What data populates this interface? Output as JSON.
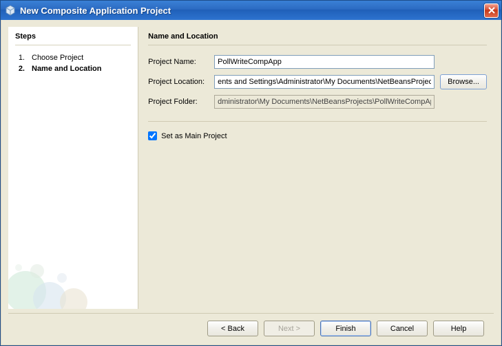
{
  "window": {
    "title": "New Composite Application Project"
  },
  "sidebar": {
    "heading": "Steps",
    "steps": [
      {
        "num": "1.",
        "label": "Choose Project"
      },
      {
        "num": "2.",
        "label": "Name and Location"
      }
    ]
  },
  "content": {
    "heading": "Name and Location",
    "project_name_label": "Project Name:",
    "project_name_value": "PollWriteCompApp",
    "project_location_label": "Project Location:",
    "project_location_value": "ents and Settings\\Administrator\\My Documents\\NetBeansProjects",
    "project_folder_label": "Project Folder:",
    "project_folder_value": "dministrator\\My Documents\\NetBeansProjects\\PollWriteCompApp",
    "browse_label": "Browse...",
    "set_main_label": "Set as Main Project",
    "set_main_checked": true
  },
  "buttons": {
    "back": "< Back",
    "next": "Next >",
    "finish": "Finish",
    "cancel": "Cancel",
    "help": "Help"
  }
}
